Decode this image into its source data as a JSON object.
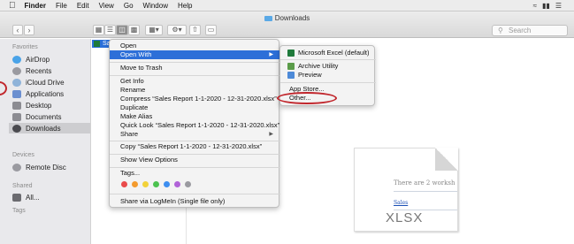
{
  "menubar": {
    "app": "Finder",
    "items": [
      "File",
      "Edit",
      "View",
      "Go",
      "Window",
      "Help"
    ]
  },
  "window": {
    "title": "Downloads",
    "search_placeholder": "Search"
  },
  "sidebar": {
    "favorites_header": "Favorites",
    "favorites": [
      {
        "label": "AirDrop",
        "icon": "airdrop-icon",
        "color": "#4aa3e8"
      },
      {
        "label": "Recents",
        "icon": "clock-icon",
        "color": "#9a9aa0"
      },
      {
        "label": "iCloud Drive",
        "icon": "cloud-icon",
        "color": "#8fb3d9"
      },
      {
        "label": "Applications",
        "icon": "applications-icon",
        "color": "#6b8fd0"
      },
      {
        "label": "Desktop",
        "icon": "desktop-icon",
        "color": "#8c8c92"
      },
      {
        "label": "Documents",
        "icon": "documents-icon",
        "color": "#8c8c92"
      },
      {
        "label": "Downloads",
        "icon": "downloads-icon",
        "color": "#4a4a4f"
      }
    ],
    "devices_header": "Devices",
    "devices": [
      {
        "label": "Remote Disc",
        "icon": "disc-icon",
        "color": "#9a9aa0"
      }
    ],
    "shared_header": "Shared",
    "shared": [
      {
        "label": "All...",
        "icon": "network-icon",
        "color": "#6b6b70"
      }
    ],
    "tags_header": "Tags"
  },
  "context_menu": {
    "open": "Open",
    "open_with": "Open With",
    "move_to_trash": "Move to Trash",
    "get_info": "Get Info",
    "rename": "Rename",
    "compress": "Compress “Sales Report 1-1-2020 - 12-31-2020.xlsx”",
    "duplicate": "Duplicate",
    "make_alias": "Make Alias",
    "quick_look": "Quick Look “Sales Report 1-1-2020 - 12-31-2020.xlsx”",
    "share": "Share",
    "copy": "Copy “Sales Report 1-1-2020 - 12-31-2020.xlsx”",
    "show_view_options": "Show View Options",
    "tags": "Tags...",
    "tag_colors": [
      "#e94b4b",
      "#f39b2f",
      "#f2d23a",
      "#4cc24f",
      "#3d8ef0",
      "#b163d8",
      "#9a9aa0"
    ],
    "share_logmein": "Share via LogMeIn (Single file only)"
  },
  "open_with_submenu": {
    "excel": "Microsoft Excel (default)",
    "archive": "Archive Utility",
    "preview": "Preview",
    "app_store": "App Store...",
    "other": "Other..."
  },
  "file": {
    "selected_label": "Sal"
  },
  "preview_doc": {
    "line1": "There are 2 worksh",
    "line2": "Sales",
    "ext": "XLSX"
  }
}
